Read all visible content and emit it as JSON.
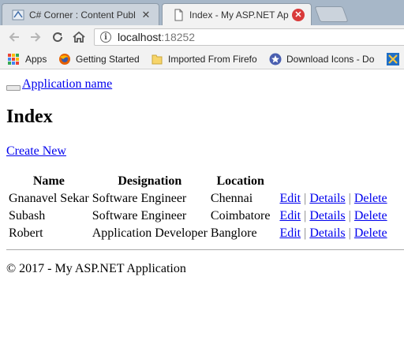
{
  "browser": {
    "tabs": [
      {
        "title": "C# Corner : Content Publ",
        "active": false,
        "favicon": "csharpcorner-favicon",
        "close": "✕"
      },
      {
        "title": "Index - My ASP.NET App",
        "active": true,
        "favicon": "document-favicon",
        "close": "✕"
      }
    ],
    "toolbar": {
      "back_icon": "arrow-left-icon",
      "forward_icon": "arrow-right-icon",
      "reload_icon": "reload-icon",
      "home_icon": "home-icon"
    },
    "address": {
      "host": "localhost",
      "port": ":18252",
      "info_glyph": "i"
    },
    "bookmarks": [
      {
        "label": "Apps",
        "icon": "apps-grid-icon"
      },
      {
        "label": "Getting Started",
        "icon": "firefox-icon"
      },
      {
        "label": "Imported From Firefo",
        "icon": "folder-icon"
      },
      {
        "label": "Download Icons - Do",
        "icon": "star-badge-icon"
      }
    ]
  },
  "colors": {
    "tabstrip": "#a7b7c8",
    "toolbar": "#f2f2f2",
    "link": "#0000ee",
    "close_active": "#d93a3a"
  },
  "page": {
    "app_name": "Application name",
    "heading": "Index",
    "create_new": "Create New",
    "table": {
      "headers": [
        "Name",
        "Designation",
        "Location",
        ""
      ],
      "rows": [
        {
          "name": "Gnanavel Sekar",
          "designation": "Software Engineer",
          "location": "Chennai"
        },
        {
          "name": "Subash",
          "designation": "Software Engineer",
          "location": "Coimbatore"
        },
        {
          "name": "Robert",
          "designation": "Application Developer",
          "location": "Banglore"
        }
      ],
      "actions": {
        "edit": "Edit",
        "details": "Details",
        "delete": "Delete",
        "separator": "|"
      }
    },
    "footer": "© 2017 - My ASP.NET Application"
  }
}
